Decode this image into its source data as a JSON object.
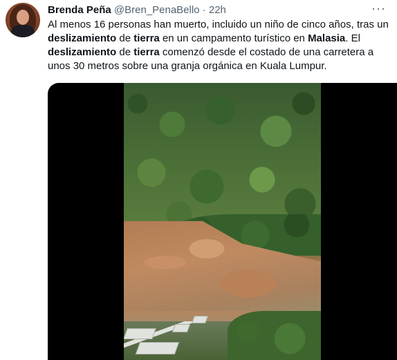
{
  "tweet": {
    "author_name": "Brenda Peña",
    "author_handle": "@Bren_PenaBello",
    "separator": "·",
    "time": "22h",
    "more_label": "···",
    "text": {
      "s1": "Al menos 16 personas han muerto, incluido un niño de cinco años, tras un ",
      "b1": "deslizamiento",
      "s2": " de ",
      "b2": "tierra",
      "s3": " en un campamento turístico en ",
      "b3": "Malasia",
      "s4": ". El ",
      "b4": "deslizamiento",
      "s5": " de ",
      "b5": "tierra",
      "s6": " comenzó desde el costado de una carretera a unos 30 metros sobre una granja orgánica en Kuala Lumpur."
    }
  },
  "icons": {
    "avatar": "profile-photo",
    "more": "more-horizontal-icon"
  }
}
